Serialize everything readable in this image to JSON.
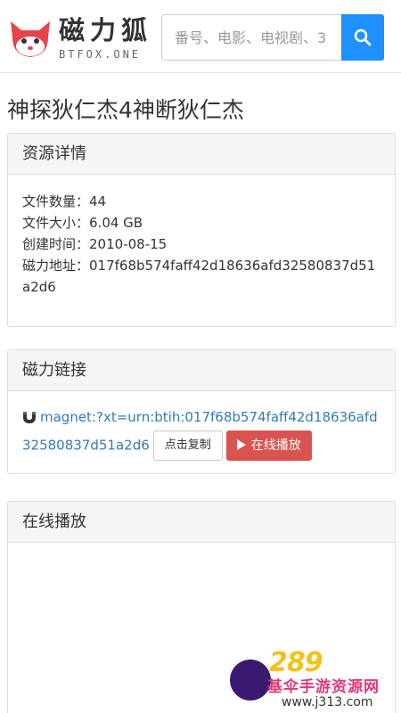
{
  "header": {
    "brand_cn": "磁力狐",
    "brand_en": "BTFOX.ONE",
    "search_placeholder": "番号、电影、电视剧、3"
  },
  "page_title": "神探狄仁杰4神断狄仁杰",
  "details": {
    "heading": "资源详情",
    "rows": [
      {
        "key": "文件数量：",
        "value": "44"
      },
      {
        "key": "文件大小：",
        "value": "6.04 GB"
      },
      {
        "key": "创建时间：",
        "value": "2010-08-15"
      },
      {
        "key": "磁力地址：",
        "value": "017f68b574faff42d18636afd32580837d51a2d6"
      }
    ]
  },
  "magnet": {
    "heading": "磁力链接",
    "link": "magnet:?xt=urn:btih:017f68b574faff42d18636afd32580837d51a2d6",
    "copy_label": "点击复制",
    "play_label": "在线播放"
  },
  "player": {
    "heading": "在线播放"
  },
  "watermark": {
    "num": "289",
    "name": "基伞手游资源网",
    "url": "www.j313.com"
  },
  "colors": {
    "accent": "#1e90ff",
    "link": "#337ab7",
    "danger": "#d9534f"
  }
}
